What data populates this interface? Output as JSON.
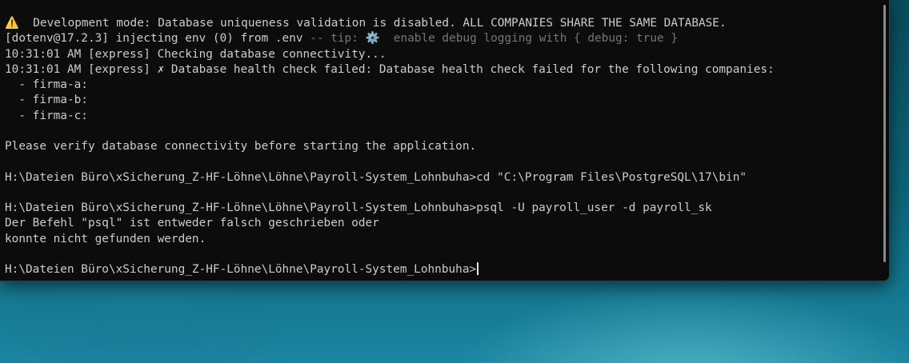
{
  "terminal": {
    "lines": [
      "⚠️  Development mode: Database uniqueness validation is disabled. ALL COMPANIES SHARE THE SAME DATABASE.",
      "[dotenv@17.2.3] injecting env (0) from .env -- tip: ⚙️  enable debug logging with { debug: true }",
      "10:31:01 AM [express] Checking database connectivity...",
      "10:31:01 AM [express] ✗ Database health check failed: Database health check failed for the following companies:",
      "  - firma-a:",
      "  - firma-b:",
      "  - firma-c:",
      "",
      "Please verify database connectivity before starting the application.",
      "",
      "H:\\Dateien Büro\\xSicherung_Z-HF-Löhne\\Löhne\\Payroll-System_Lohnbuha>cd \"C:\\Program Files\\PostgreSQL\\17\\bin\"",
      "",
      "H:\\Dateien Büro\\xSicherung_Z-HF-Löhne\\Löhne\\Payroll-System_Lohnbuha>psql -U payroll_user -d payroll_sk",
      "Der Befehl \"psql\" ist entweder falsch geschrieben oder",
      "konnte nicht gefunden werden.",
      "",
      "H:\\Dateien Büro\\xSicherung_Z-HF-Löhne\\Löhne\\Payroll-System_Lohnbuha>"
    ],
    "colors": {
      "background": "#0c0c0c",
      "text": "#cccccc",
      "warning": "#e8b400",
      "dim": "#767676"
    }
  }
}
